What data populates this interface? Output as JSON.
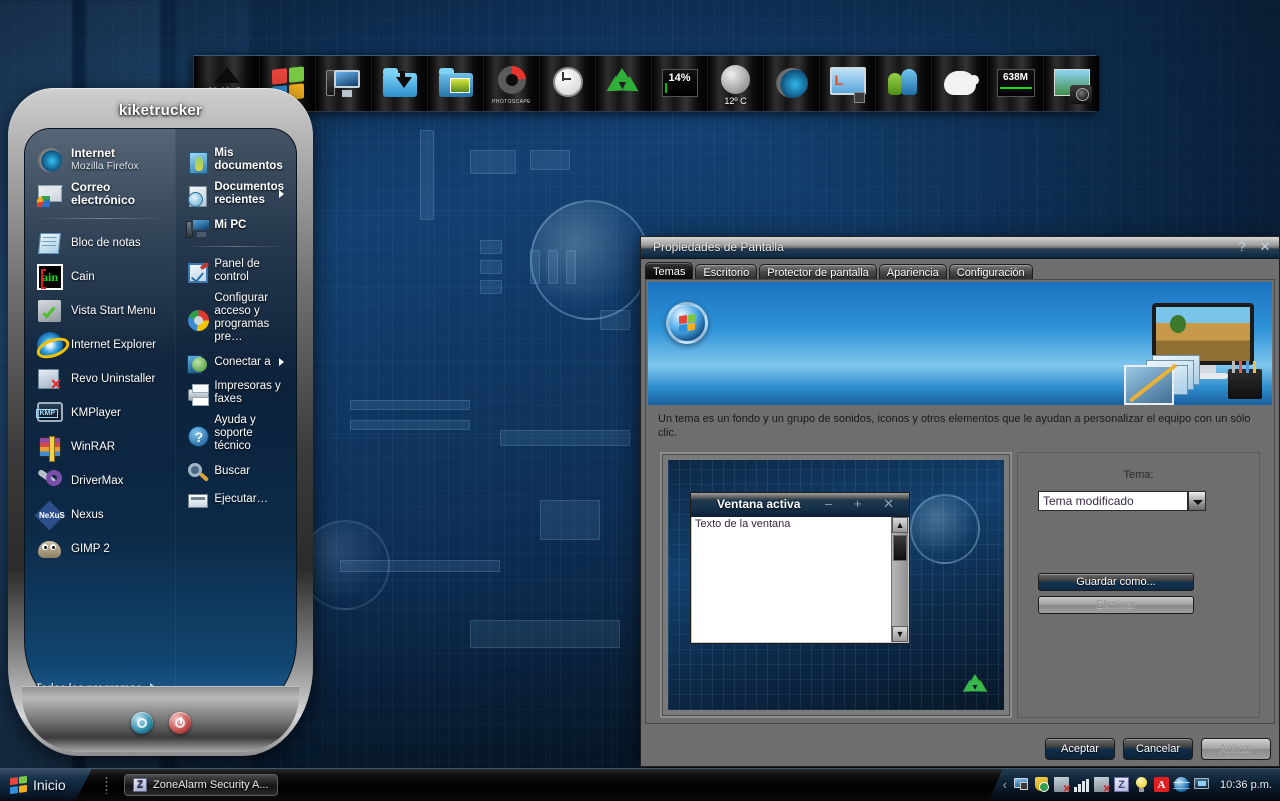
{
  "desktop": {
    "wallpaper_description": "blue x-ray circuit board wallpaper",
    "accent_blue": "#12406d",
    "dark_panel": "#0b0b0b"
  },
  "dock": {
    "items": [
      {
        "name": "nexus-dock-logo",
        "label": "NeXuS",
        "icon": "nexus-icon"
      },
      {
        "name": "windows-start-orb",
        "label": "",
        "icon": "windows-flag-icon"
      },
      {
        "name": "my-computer",
        "label": "",
        "icon": "computer-icon"
      },
      {
        "name": "downloads-folder",
        "label": "",
        "icon": "folder-download-icon"
      },
      {
        "name": "media-library",
        "label": "",
        "icon": "picture-folder-icon"
      },
      {
        "name": "photoscape",
        "label": "PHOTOSCAPE",
        "icon": "photoscape-icon"
      },
      {
        "name": "clock-widget",
        "label": "",
        "icon": "clock-icon"
      },
      {
        "name": "recycle-bin",
        "label": "",
        "icon": "recycle-icon"
      },
      {
        "name": "cpu-meter",
        "label": "14%",
        "icon": "cpu-gauge-icon"
      },
      {
        "name": "weather-widget",
        "label": "12º C",
        "icon": "moon-weather-icon"
      },
      {
        "name": "firefox",
        "label": "",
        "icon": "firefox-icon"
      },
      {
        "name": "litestep-monitor",
        "label": "",
        "icon": "monitor-save-icon"
      },
      {
        "name": "messenger",
        "label": "",
        "icon": "people-icon"
      },
      {
        "name": "cow-app",
        "label": "",
        "icon": "cow-icon"
      },
      {
        "name": "memory-meter",
        "label": "638M",
        "icon": "memory-gauge-icon"
      },
      {
        "name": "camera-gallery",
        "label": "",
        "icon": "camera-icon"
      }
    ]
  },
  "start_menu": {
    "username": "kiketrucker",
    "left_items": [
      {
        "label": "Internet",
        "sublabel": "Mozilla Firefox",
        "icon": "firefox-icon",
        "bold": true
      },
      {
        "label": "Correo electrónico",
        "sublabel": "",
        "icon": "mail-icon",
        "bold": true
      },
      {
        "label": "Bloc de notas",
        "sublabel": "",
        "icon": "notepad-icon",
        "bold": false
      },
      {
        "label": "Cain",
        "sublabel": "",
        "icon": "cain-icon",
        "bold": false
      },
      {
        "label": "Vista Start Menu",
        "sublabel": "",
        "icon": "vista-start-menu-icon",
        "bold": false
      },
      {
        "label": "Internet Explorer",
        "sublabel": "",
        "icon": "internet-explorer-icon",
        "bold": false
      },
      {
        "label": "Revo Uninstaller",
        "sublabel": "",
        "icon": "revo-uninstaller-icon",
        "bold": false
      },
      {
        "label": "KMPlayer",
        "sublabel": "",
        "icon": "kmplayer-icon",
        "bold": false
      },
      {
        "label": "WinRAR",
        "sublabel": "",
        "icon": "winrar-icon",
        "bold": false
      },
      {
        "label": "DriverMax",
        "sublabel": "",
        "icon": "drivermax-icon",
        "bold": false
      },
      {
        "label": "Nexus",
        "sublabel": "",
        "icon": "nexus-icon",
        "bold": false
      },
      {
        "label": "GIMP 2",
        "sublabel": "",
        "icon": "gimp-icon",
        "bold": false
      }
    ],
    "right_items": [
      {
        "label": "Mis documentos",
        "icon": "my-documents-icon",
        "bold": true,
        "arrow": false
      },
      {
        "label": "Documentos recientes",
        "icon": "recent-documents-icon",
        "bold": true,
        "arrow": true
      },
      {
        "label": "Mi PC",
        "icon": "my-computer-icon",
        "bold": true,
        "arrow": false
      },
      {
        "label": "Panel de control",
        "icon": "control-panel-icon",
        "bold": false,
        "arrow": false
      },
      {
        "label": "Configurar acceso y programas pre…",
        "icon": "set-program-access-icon",
        "bold": false,
        "arrow": false
      },
      {
        "label": "Conectar a",
        "icon": "connect-to-icon",
        "bold": false,
        "arrow": true
      },
      {
        "label": "Impresoras y faxes",
        "icon": "printers-faxes-icon",
        "bold": false,
        "arrow": false
      },
      {
        "label": "Ayuda y soporte técnico",
        "icon": "help-support-icon",
        "bold": false,
        "arrow": false
      },
      {
        "label": "Buscar",
        "icon": "search-icon",
        "bold": false,
        "arrow": false
      },
      {
        "label": "Ejecutar…",
        "icon": "run-icon",
        "bold": false,
        "arrow": false
      }
    ],
    "all_programs_label": "Todos los programas",
    "logoff_button": "logoff-icon",
    "shutdown_button": "shutdown-icon"
  },
  "dialog": {
    "title": "Propiedades de Pantalla",
    "help_button": "?",
    "close_button": "✕",
    "tabs": [
      {
        "label": "Temas",
        "active": true
      },
      {
        "label": "Escritorio",
        "active": false
      },
      {
        "label": "Protector de pantalla",
        "active": false
      },
      {
        "label": "Apariencia",
        "active": false
      },
      {
        "label": "Configuración",
        "active": false
      }
    ],
    "description": "Un tema es un fondo y un grupo de sonidos, iconos y otros elementos que le ayudan a personalizar el equipo con un sólo clic.",
    "preview": {
      "window_title": "Ventana activa",
      "window_text": "Texto de la ventana",
      "minimize": "–",
      "maximize": "+",
      "close": "✕"
    },
    "theme_group": {
      "label": "Tema:",
      "selected_theme": "Tema modificado",
      "save_as_button": "Guardar como...",
      "delete_button": "Eliminar"
    },
    "buttons": {
      "ok": "Aceptar",
      "cancel": "Cancelar",
      "apply": "Aplicar"
    }
  },
  "taskbar": {
    "start_label": "Inicio",
    "tasks": [
      {
        "label": "ZoneAlarm Security A...",
        "icon": "zonealarm-icon"
      }
    ],
    "tray": {
      "chevron": "‹",
      "icons": [
        "monitor-save-icon",
        "security-shield-icon",
        "network-disconnected-icon",
        "signal-bars-icon",
        "network-disconnected-2-icon",
        "zonealarm-tray-icon",
        "lightbulb-icon",
        "avira-icon",
        "globe-icon",
        "display-settings-icon"
      ],
      "clock": "10:36 p.m."
    }
  }
}
